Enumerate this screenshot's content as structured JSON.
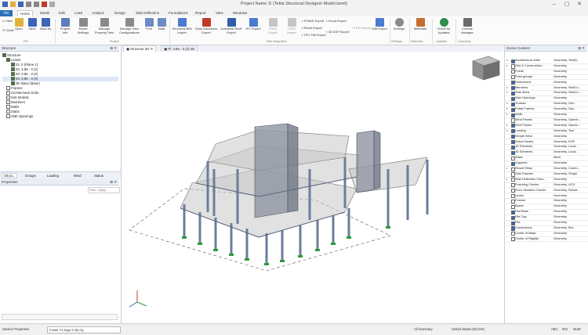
{
  "window": {
    "title": "Project Name 1I (Tekla Structural Designer Model.tsmd)",
    "controls": [
      "–",
      "▢",
      "✕"
    ]
  },
  "menu": {
    "file": "File",
    "tabs": [
      "Home",
      "Model",
      "Edit",
      "Load",
      "Analyze",
      "Design",
      "Slab Deflection",
      "Foundations",
      "Report",
      "View",
      "Windows"
    ],
    "active": "Home"
  },
  "ribbon": {
    "buttons": [
      {
        "label": "Open",
        "icon": "folder-icon",
        "color": "#e3b23c"
      },
      {
        "label": "Save",
        "icon": "save-icon",
        "color": "#3b66b6"
      },
      {
        "label": "Save As",
        "icon": "save-as-icon",
        "color": "#3b66b6"
      },
      {
        "label": "Project Info",
        "icon": "info-icon",
        "color": "#5a7fb8"
      },
      {
        "label": "Model Settings",
        "icon": "settings-icon",
        "color": "#8a8a8a"
      },
      {
        "label": "Manage Property Sets",
        "icon": "property-icon",
        "color": "#8a8a8a"
      },
      {
        "label": "Manage View Configurations",
        "icon": "view-config-icon",
        "color": "#8a8a8a"
      },
      {
        "label": "Find",
        "icon": "find-icon",
        "color": "#6b8bc4"
      },
      {
        "label": "Walk",
        "icon": "walk-icon",
        "color": "#6b8bc4"
      },
      {
        "label": "Structural BIM Import",
        "icon": "bim-import-icon",
        "color": "#4a7bd1"
      },
      {
        "label": "Tekla Structures Export",
        "icon": "tekla-export-icon",
        "color": "#c0392b"
      },
      {
        "label": "Autodesk Revit Export",
        "icon": "revit-export-icon",
        "color": "#2f5fa8"
      },
      {
        "label": "IFC Export",
        "icon": "ifc-icon",
        "color": "#4a7bd1"
      },
      {
        "label": "CIS/2 Export",
        "icon": "cis2-icon",
        "color": "#9a9a9a"
      },
      {
        "label": "CIS/2 Import",
        "icon": "cis2-import-icon",
        "color": "#9a9a9a"
      },
      {
        "label": "ISM Export",
        "icon": "ism-export-icon",
        "color": "#4a7bd1"
      },
      {
        "label": "Settings",
        "icon": "gear-icon",
        "color": "#8a8a8a"
      },
      {
        "label": "Materials",
        "icon": "materials-icon",
        "color": "#c46f2f"
      },
      {
        "label": "Check for Updates",
        "icon": "update-icon",
        "color": "#2a8f4a"
      },
      {
        "label": "License Manager",
        "icon": "license-icon",
        "color": "#6a6a6a"
      }
    ],
    "small_buttons": [
      "Close",
      "STAAD Export",
      "Robot Export",
      "Cloud Export",
      "TEC File Export",
      "3D DXF Export",
      "TED Export"
    ],
    "groups": [
      "File",
      "Project",
      "BIM Integration",
      "Settings",
      "Materials",
      "Updates",
      "Licensing"
    ]
  },
  "structure_panel": {
    "title": "Structure",
    "tree": [
      {
        "label": "Structure",
        "depth": 0,
        "checked": true
      },
      {
        "label": "Levels",
        "depth": 1,
        "checked": true
      },
      {
        "label": "01: 0 (Plane 1)",
        "depth": 2,
        "checked": true
      },
      {
        "label": "02: 3.85 - 3 (2)",
        "depth": 2,
        "checked": true
      },
      {
        "label": "03: 3.85 - 3 (3)",
        "depth": 2,
        "checked": true
      },
      {
        "label": "04: 3.85 - 3 (4)",
        "depth": 2,
        "checked": true
      },
      {
        "label": "05: Base (Base)",
        "depth": 2,
        "checked": true
      },
      {
        "label": "Frames",
        "depth": 1,
        "checked": false
      },
      {
        "label": "Architectural Grids",
        "depth": 1,
        "checked": false
      },
      {
        "label": "Sub Models",
        "depth": 1,
        "checked": false
      },
      {
        "label": "Members",
        "depth": 1,
        "checked": false
      },
      {
        "label": "Walls",
        "depth": 1,
        "checked": false
      },
      {
        "label": "Slabs",
        "depth": 1,
        "checked": false
      },
      {
        "label": "Slab Openings",
        "depth": 1,
        "checked": false
      }
    ],
    "bottom_tabs": [
      "Struct...",
      "Groups",
      "Loading",
      "Wind",
      "Status"
    ]
  },
  "properties_panel": {
    "title": "Properties",
    "filter_label": "Filter / Apply..."
  },
  "view_tabs": [
    "Structure 3D",
    "Pl. 3.85 - 3 (2) 3D"
  ],
  "scene_panel": {
    "title": "Scene Content",
    "rows": [
      {
        "name": "Architectural Grids",
        "value": "Geometry, Text(2)",
        "checked": true,
        "expand": true
      },
      {
        "name": "Grid & Construction ...",
        "value": "Geometry",
        "checked": false,
        "expand": true
      },
      {
        "name": "Points",
        "value": "Geometry",
        "checked": false,
        "expand": false
      },
      {
        "name": "Point groups",
        "value": "Geometry",
        "checked": false,
        "expand": false
      },
      {
        "name": "Dimensions",
        "value": "Geometry",
        "checked": true,
        "expand": false
      },
      {
        "name": "Members",
        "value": "Geometry, SlabCo...",
        "checked": true,
        "expand": true
      },
      {
        "name": "Slab Items",
        "value": "Geometry, SlabCo...",
        "checked": true,
        "expand": true
      },
      {
        "name": "Slab Openings",
        "value": "Geometry",
        "checked": true,
        "expand": false
      },
      {
        "name": "Trusses",
        "value": "Geometry, Geo...",
        "checked": true,
        "expand": true
      },
      {
        "name": "Portal Frames",
        "value": "Geometry, Geo...",
        "checked": true,
        "expand": true
      },
      {
        "name": "Walls",
        "value": "Geometry",
        "checked": true,
        "expand": true
      },
      {
        "name": "Wind Panels",
        "value": "Geometry, Openin...",
        "checked": false,
        "expand": false
      },
      {
        "name": "Roof Panels",
        "value": "Geometry, Openin...",
        "checked": true,
        "expand": true
      },
      {
        "name": "Loading",
        "value": "Geometry, Text",
        "checked": true,
        "expand": true
      },
      {
        "name": "Simple Wind",
        "value": "Geometry",
        "checked": true,
        "expand": false
      },
      {
        "name": "Solver Nodes",
        "value": "Geometry, DOF",
        "checked": true,
        "expand": false
      },
      {
        "name": "1D Elements",
        "value": "Geometry, Local...",
        "checked": true,
        "expand": false
      },
      {
        "name": "2D Elements",
        "value": "Geometry, Local...",
        "checked": true,
        "expand": false
      },
      {
        "name": "Slabs",
        "value": "Mesh",
        "checked": false,
        "expand": false
      },
      {
        "name": "Supports",
        "value": "Geometry",
        "checked": true,
        "expand": false
      },
      {
        "name": "Result Strips",
        "value": "Geometry, Contro...",
        "checked": false,
        "expand": true
      },
      {
        "name": "Slab Patches",
        "value": "Geometry, Shape",
        "checked": false,
        "expand": false
      },
      {
        "name": "Slab Deflection Chec...",
        "value": "Geometry",
        "checked": false,
        "expand": true
      },
      {
        "name": "Punching Checks",
        "value": "Geometry, UCS",
        "checked": false,
        "expand": false
      },
      {
        "name": "Floor Vibration Checks",
        "value": "Geometry, Result...",
        "checked": false,
        "expand": false
      },
      {
        "name": "Levels",
        "value": "Geometry",
        "checked": false,
        "expand": false
      },
      {
        "name": "Frames",
        "value": "Geometry",
        "checked": false,
        "expand": false
      },
      {
        "name": "Bases",
        "value": "Geometry",
        "checked": false,
        "expand": false
      },
      {
        "name": "Pad Base",
        "value": "Geometry",
        "checked": true,
        "expand": false
      },
      {
        "name": "Pile Cap",
        "value": "Geometry",
        "checked": true,
        "expand": false
      },
      {
        "name": "Pile",
        "value": "Geometry",
        "checked": true,
        "expand": false
      },
      {
        "name": "Connections",
        "value": "Geometry, Box",
        "checked": true,
        "expand": false
      },
      {
        "name": "Center of Mass",
        "value": "Geometry",
        "checked": false,
        "expand": false
      },
      {
        "name": "Center of Rigidity",
        "value": "Geometry",
        "checked": false,
        "expand": false
      }
    ]
  },
  "status": {
    "left": "Section Properties",
    "selector": "F.Wall +H.26(pl.3.35) Op",
    "summary": "All Summary",
    "units": "United States (EC/UK)",
    "indicators": [
      "ABC",
      "INS",
      "NUM"
    ]
  },
  "accent": "#2b6fb6"
}
